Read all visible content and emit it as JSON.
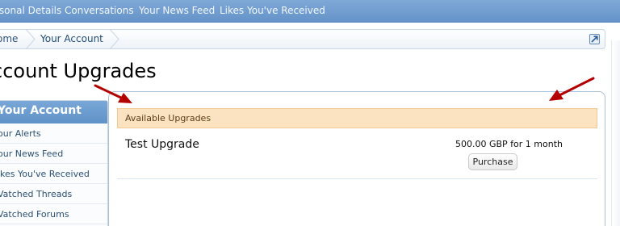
{
  "topnav": {
    "tabs": [
      {
        "label": "rsonal Details"
      },
      {
        "label": "Conversations"
      },
      {
        "label": "Your News Feed"
      },
      {
        "label": "Likes You've Received"
      }
    ]
  },
  "breadcrumb": {
    "items": [
      {
        "label": "ome"
      },
      {
        "label": "Your Account"
      }
    ]
  },
  "page": {
    "title": "ccount Upgrades"
  },
  "sidebar": {
    "heading": "Your Account",
    "items": [
      {
        "label": "our Alerts"
      },
      {
        "label": "our News Feed"
      },
      {
        "label": "ikes You've Received"
      },
      {
        "label": "Vatched Threads"
      },
      {
        "label": "Vatched Forums"
      }
    ]
  },
  "upgrades": {
    "section_heading": "Available Upgrades",
    "items": [
      {
        "name": "Test Upgrade",
        "price": "500.00 GBP for 1 month",
        "button_label": "Purchase"
      }
    ]
  },
  "colors": {
    "nav": "#6f9ccf",
    "sidebar_heading": "#6b9bcf",
    "upgrades_header_bg": "#fbe3c2",
    "annotation_arrow": "#c00000"
  }
}
